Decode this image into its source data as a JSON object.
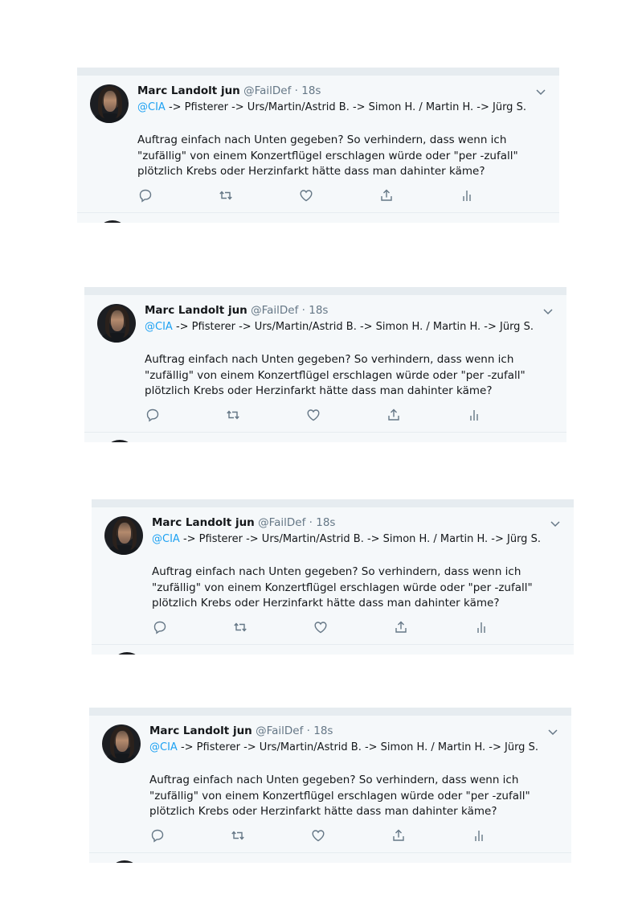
{
  "tweets": [
    {
      "name": "Marc Landolt jun",
      "handle": "@FailDef",
      "separator": " · ",
      "time": "18s",
      "mention": "@CIA",
      "reply_chain": " -> Pfisterer -> Urs/Martin/Astrid B. -> Simon H. / Martin H. -> Jürg S.",
      "text_lines": [
        "Auftrag einfach nach Unten gegeben? So verhindern, dass wenn ich",
        "\"zufällig\" von einem Konzertflügel erschlagen würde oder \"per -zufall\"",
        "plötzlich Krebs oder Herzinfarkt hätte dass man dahinter käme?"
      ]
    },
    {
      "name": "Marc Landolt jun",
      "handle": "@FailDef",
      "separator": " · ",
      "time": "18s",
      "mention": "@CIA",
      "reply_chain": " -> Pfisterer -> Urs/Martin/Astrid B. -> Simon H. / Martin H. -> Jürg S.",
      "text_lines": [
        "Auftrag einfach nach Unten gegeben? So verhindern, dass wenn ich",
        "\"zufällig\" von einem Konzertflügel erschlagen würde oder \"per -zufall\"",
        "plötzlich Krebs oder Herzinfarkt hätte dass man dahinter käme?"
      ]
    },
    {
      "name": "Marc Landolt jun",
      "handle": "@FailDef",
      "separator": " · ",
      "time": "18s",
      "mention": "@CIA",
      "reply_chain": " -> Pfisterer -> Urs/Martin/Astrid B. -> Simon H. / Martin H. -> Jürg S.",
      "text_lines": [
        "Auftrag einfach nach Unten gegeben? So verhindern, dass wenn ich",
        "\"zufällig\" von einem Konzertflügel erschlagen würde oder \"per -zufall\"",
        "plötzlich Krebs oder Herzinfarkt hätte dass man dahinter käme?"
      ]
    },
    {
      "name": "Marc Landolt jun",
      "handle": "@FailDef",
      "separator": " · ",
      "time": "18s",
      "mention": "@CIA",
      "reply_chain": " -> Pfisterer -> Urs/Martin/Astrid B. -> Simon H. / Martin H. -> Jürg S.",
      "text_lines": [
        "Auftrag einfach nach Unten gegeben? So verhindern, dass wenn ich",
        "\"zufällig\" von einem Konzertflügel erschlagen würde oder \"per -zufall\"",
        "plötzlich Krebs oder Herzinfarkt hätte dass man dahinter käme?"
      ]
    }
  ],
  "icons": {
    "reply": "reply-icon",
    "retweet": "retweet-icon",
    "like": "like-icon",
    "share": "share-icon",
    "analytics": "analytics-icon",
    "menu": "chevron-down-icon"
  },
  "colors": {
    "card_background": "#f5f8fa",
    "card_border": "#e6ecf0",
    "mention": "#1da1f2",
    "secondary_text": "#657786",
    "icon": "#657786"
  }
}
